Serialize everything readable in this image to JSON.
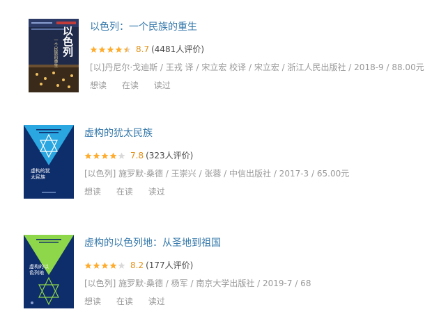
{
  "books": [
    {
      "title": "以色列：一个民族的重生",
      "rating_value": 8.7,
      "score": "8.7",
      "count": "(4481人评价)",
      "publication": "[以]丹尼尔·戈迪斯 / 王戎 译 / 宋立宏 校译 / 宋立宏 / 浙江人民出版社 / 2018-9 / 88.00元",
      "actions": [
        "想读",
        "在读",
        "读过"
      ],
      "cover": {
        "text_main": "以色列",
        "text_sub": "一个民族的重生",
        "bg": "#1f2a4a",
        "accent": "#e8b04a"
      }
    },
    {
      "title": "虚构的犹太民族",
      "rating_value": 7.8,
      "score": "7.8",
      "count": "(323人评价)",
      "publication": "[以色列] 施罗默·桑德 / 王崇兴 / 张蓉 / 中信出版社 / 2017-3 / 65.00元",
      "actions": [
        "想读",
        "在读",
        "读过"
      ],
      "cover": {
        "text_main": "虚构的犹太民族",
        "bg": "#0e2d6b",
        "accent": "#2aa6e0"
      }
    },
    {
      "title": "虚构的以色列地：从圣地到祖国",
      "rating_value": 8.2,
      "score": "8.2",
      "count": "(177人评价)",
      "publication": "[以色列] 施罗默·桑德 / 杨军 / 南京大学出版社 / 2019-7 / 68",
      "actions": [
        "想读",
        "在读",
        "读过"
      ],
      "cover": {
        "text_main": "虚构的以色列地",
        "bg": "#0e2d6b",
        "accent": "#8ed64a"
      }
    }
  ],
  "colors": {
    "title_link": "#3377aa",
    "star_full": "#ffac2d",
    "star_empty": "#d9d9d9",
    "score": "#e09015"
  }
}
